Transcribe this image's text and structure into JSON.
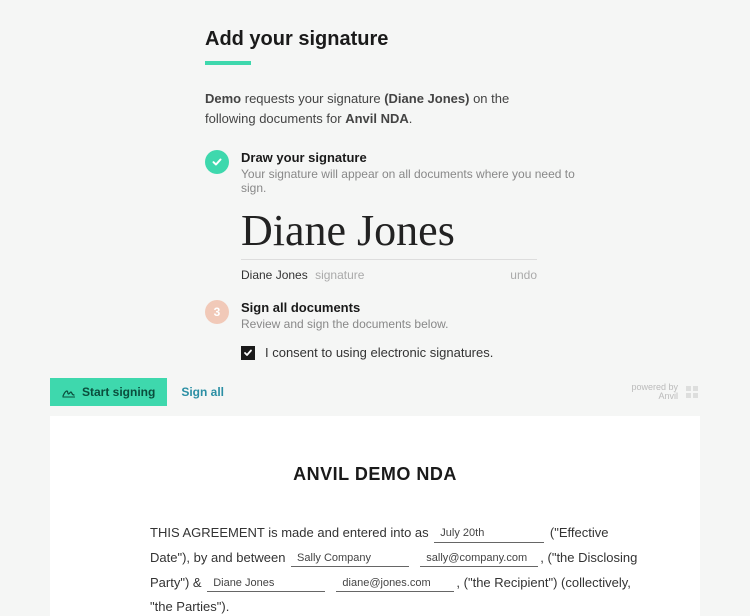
{
  "page": {
    "title": "Add your signature",
    "intro_prefix": "Demo",
    "intro_mid": " requests your signature ",
    "intro_name": "(Diane Jones)",
    "intro_suffix_1": " on the following documents for ",
    "intro_doc": "Anvil NDA",
    "intro_suffix_2": "."
  },
  "step_draw": {
    "title": "Draw your signature",
    "subtitle": "Your signature will appear on all documents where you need to sign."
  },
  "signature": {
    "script": "Diane Jones",
    "name": "Diane Jones",
    "label": "signature",
    "undo": "undo"
  },
  "step_sign": {
    "number": "3",
    "title": "Sign all documents",
    "subtitle": "Review and sign the documents below."
  },
  "consent": {
    "text": "I consent to using electronic signatures."
  },
  "toolbar": {
    "start": "Start signing",
    "sign_all": "Sign all",
    "powered_line1": "powered by",
    "powered_line2": "Anvil"
  },
  "document": {
    "title": "ANVIL DEMO NDA",
    "text": {
      "p1_a": "THIS AGREEMENT is made and entered into as ",
      "p1_b": " (\"Effective Date\"), by and between ",
      "p1_c": ", (\"the Disclosing Party\") & ",
      "p1_d": ", (\"the Recipient\") (collectively, \"the Parties\")."
    },
    "fields": {
      "effective_date": "July 20th",
      "disclosing_party": "Sally Company",
      "disclosing_email": "sally@company.com",
      "recipient_name": "Diane Jones",
      "recipient_email": "diane@jones.com"
    }
  }
}
